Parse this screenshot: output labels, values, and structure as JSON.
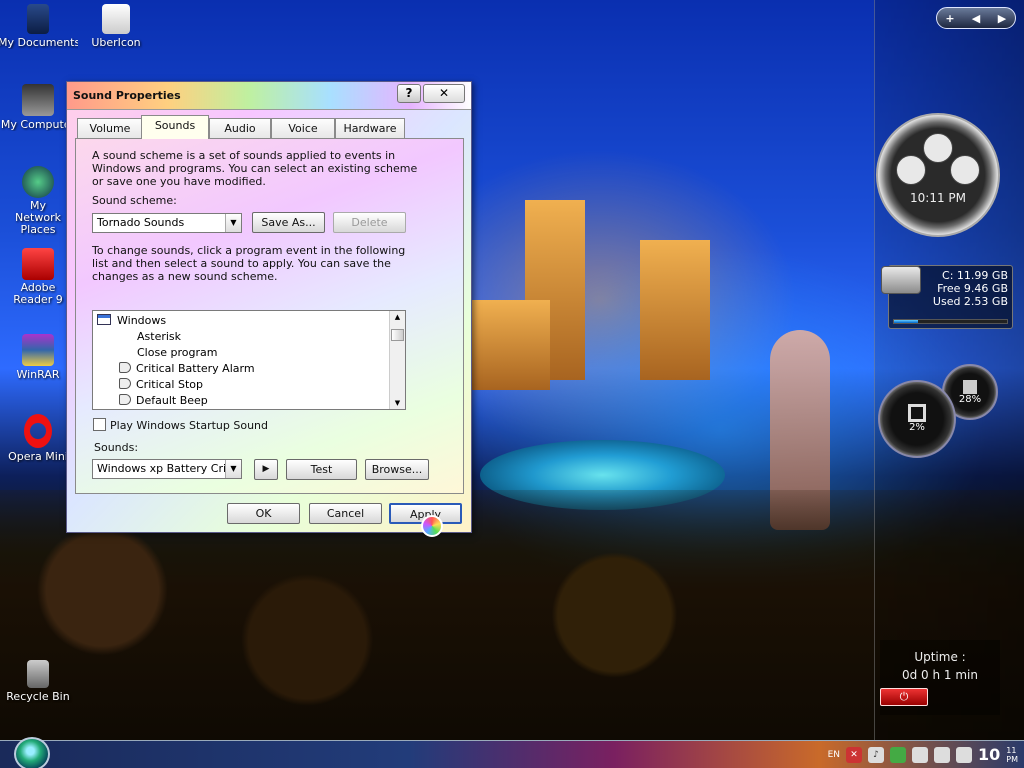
{
  "desktop": {
    "icons": [
      {
        "label": "My Documents"
      },
      {
        "label": "UberIcon"
      },
      {
        "label": "My Computer"
      },
      {
        "label": "My Network Places"
      },
      {
        "label": "Adobe Reader 9"
      },
      {
        "label": "WinRAR"
      },
      {
        "label": "Opera Mini"
      },
      {
        "label": "Recycle Bin"
      }
    ]
  },
  "dialog": {
    "title": "Sound Properties",
    "help_glyph": "?",
    "close_glyph": "✕",
    "tabs": [
      {
        "label": "Volume"
      },
      {
        "label": "Sounds"
      },
      {
        "label": "Audio"
      },
      {
        "label": "Voice"
      },
      {
        "label": "Hardware"
      }
    ],
    "active_tab": "Sounds",
    "intro": "A sound scheme is a set of sounds applied to events in Windows and programs.  You can select an existing scheme or save one you have modified.",
    "scheme_label": "Sound scheme:",
    "scheme_value": "Tornado Sounds",
    "save_as": "Save As...",
    "delete": "Delete",
    "instructions": "To change sounds, click a program event in the following list and then select a sound to apply.  You can save the changes as a new sound scheme.",
    "events": [
      {
        "label": "Windows",
        "kind": "group"
      },
      {
        "label": "Asterisk",
        "kind": "plain"
      },
      {
        "label": "Close program",
        "kind": "plain"
      },
      {
        "label": "Critical Battery Alarm",
        "kind": "sound"
      },
      {
        "label": "Critical Stop",
        "kind": "sound"
      },
      {
        "label": "Default Beep",
        "kind": "sound"
      }
    ],
    "startup_sound_label": "Play Windows Startup Sound",
    "sounds_label": "Sounds:",
    "sounds_value": "Windows xp Battery Critica",
    "play_glyph": "▶",
    "test": "Test",
    "browse": "Browse...",
    "ok": "OK",
    "cancel": "Cancel",
    "apply": "Apply"
  },
  "sidebar": {
    "controls": [
      "+",
      "◀",
      "▶"
    ],
    "clock": {
      "time": "10:11 PM"
    },
    "drive": {
      "name": "C:  11.99 GB",
      "free": "Free 9.46 GB",
      "used": "Used 2.53 GB",
      "used_fraction": 0.21
    },
    "gauges": {
      "cpu": "2%",
      "mem": "28%"
    },
    "uptime": {
      "label": "Uptime :",
      "value": "0d 0 h 1 min"
    }
  },
  "taskbar": {
    "lang": "EN",
    "time": "10",
    "time_minutes": "11",
    "ampm": "PM"
  },
  "colors": {
    "accent": "#3a73d8",
    "apply_border": "#2a5ab8"
  }
}
